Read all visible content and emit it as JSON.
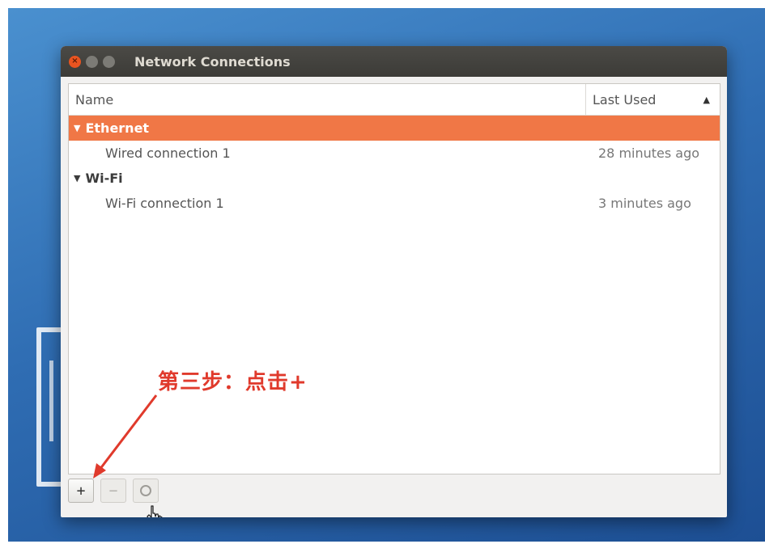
{
  "window": {
    "title": "Network Connections"
  },
  "columns": {
    "name": "Name",
    "last_used": "Last Used",
    "sort_icon": "sort-ascending-icon"
  },
  "groups": [
    {
      "label": "Ethernet",
      "selected": true,
      "connections": [
        {
          "name": "Wired connection 1",
          "last_used": "28 minutes ago"
        }
      ]
    },
    {
      "label": "Wi-Fi",
      "selected": false,
      "connections": [
        {
          "name": "Wi-Fi connection 1",
          "last_used": "3 minutes ago"
        }
      ]
    }
  ],
  "toolbar": {
    "add_label": "+",
    "remove_label": "−",
    "settings_icon": "gear-icon"
  },
  "annotation": {
    "text": "第三步：点击+"
  },
  "colors": {
    "selection": "#f07746",
    "annotation": "#e03a2c",
    "close_button": "#e95420"
  }
}
